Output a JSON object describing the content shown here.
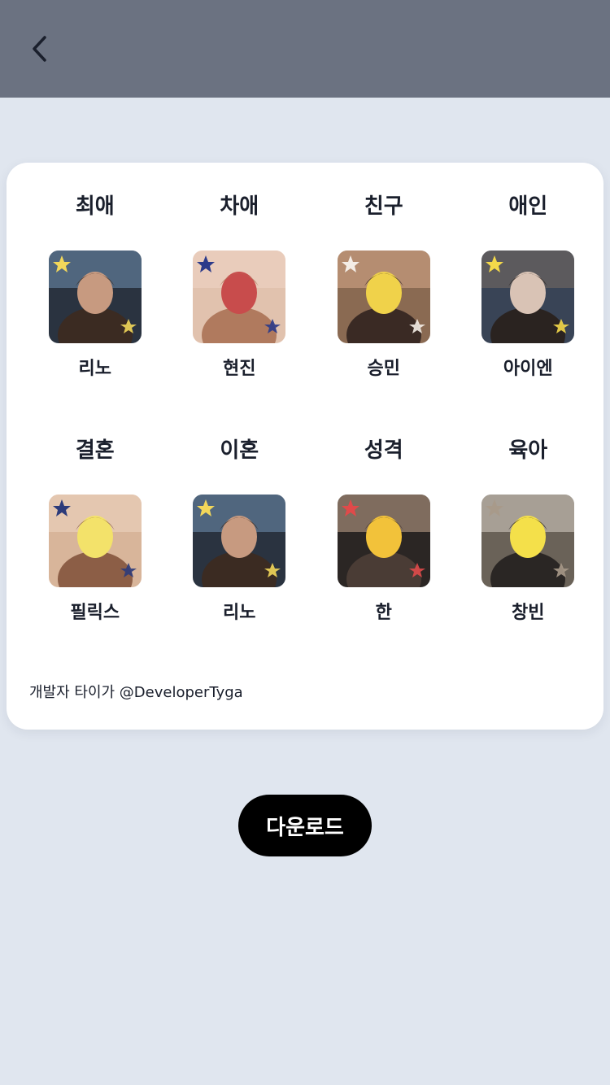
{
  "header": {
    "back_icon": "chevron-left-icon",
    "background_color": "#6b7281"
  },
  "card": {
    "items": [
      {
        "title": "최애",
        "name": "리노",
        "palette": [
          "#2a3340",
          "#6f8fb0",
          "#3b2b22",
          "#c79a80",
          "#f2d75a"
        ]
      },
      {
        "title": "차애",
        "name": "현진",
        "palette": [
          "#e1c2ae",
          "#f0d6c6",
          "#b07a5e",
          "#c84c4c",
          "#2b3a8a"
        ]
      },
      {
        "title": "친구",
        "name": "승민",
        "palette": [
          "#8a6a52",
          "#d8a98a",
          "#3a2a24",
          "#f0d24a",
          "#f4ede6"
        ]
      },
      {
        "title": "애인",
        "name": "아이엔",
        "palette": [
          "#394456",
          "#7a6e64",
          "#2a2320",
          "#d9c3b5",
          "#f4d94a"
        ]
      },
      {
        "title": "결혼",
        "name": "필릭스",
        "palette": [
          "#d8b59a",
          "#efd6c2",
          "#8c5e46",
          "#f3e26a",
          "#2c3b7a"
        ]
      },
      {
        "title": "이혼",
        "name": "리노",
        "palette": [
          "#2a3340",
          "#6f8fb0",
          "#3b2b22",
          "#c79a80",
          "#f2d75a"
        ]
      },
      {
        "title": "성격",
        "name": "한",
        "palette": [
          "#2b2624",
          "#c4a58e",
          "#4a3c35",
          "#f2c23a",
          "#e04a4a"
        ]
      },
      {
        "title": "육아",
        "name": "창빈",
        "palette": [
          "#6a6258",
          "#d8d2c8",
          "#2a2624",
          "#f4e04a",
          "#a89a8a"
        ]
      }
    ],
    "credit": "개발자 타이가 @DeveloperTyga"
  },
  "download": {
    "label": "다운로드"
  }
}
